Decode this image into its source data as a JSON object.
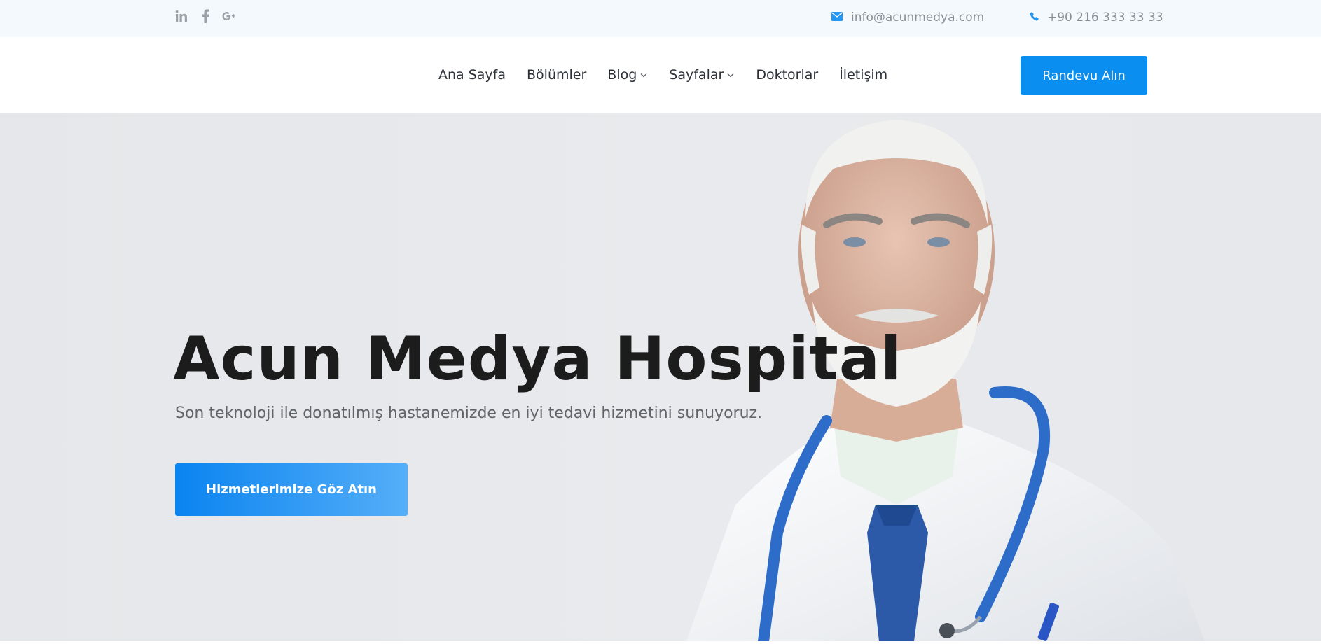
{
  "topbar": {
    "social_icons": [
      "linkedin-icon",
      "facebook-icon",
      "google-plus-icon"
    ],
    "email": "info@acunmedya.com",
    "phone": "+90 216 333 33 33",
    "icon_color": "#9aa0a6",
    "accent_icon_color": "#2196f3"
  },
  "nav": {
    "items": [
      {
        "label": "Ana Sayfa",
        "has_dropdown": false
      },
      {
        "label": "Bölümler",
        "has_dropdown": false
      },
      {
        "label": "Blog",
        "has_dropdown": true
      },
      {
        "label": "Sayfalar",
        "has_dropdown": true
      },
      {
        "label": "Doktorlar",
        "has_dropdown": false
      },
      {
        "label": "İletişim",
        "has_dropdown": false
      }
    ],
    "cta_label": "Randevu Alın"
  },
  "hero": {
    "title": "Acun Medya Hospital",
    "subtitle": "Son teknoloji ile donatılmış hastanemizde en iyi tedavi hizmetini sunuyoruz.",
    "cta_label": "Hizmetlerimize Göz Atın"
  },
  "colors": {
    "primary": "#0a8ff1",
    "topbar_bg": "#f4f9fe",
    "hero_bg": "#e7e9ec",
    "title": "#1c1c1c"
  }
}
